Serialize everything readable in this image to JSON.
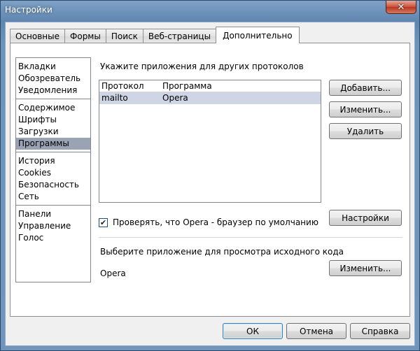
{
  "window": {
    "title": "Настройки",
    "close_label": "✕"
  },
  "tabs": [
    {
      "label": "Основные"
    },
    {
      "label": "Формы"
    },
    {
      "label": "Поиск"
    },
    {
      "label": "Веб-страницы"
    },
    {
      "label": "Дополнительно",
      "active": true
    }
  ],
  "sidebar": {
    "groups": [
      [
        "Вкладки",
        "Обозреватель",
        "Уведомления"
      ],
      [
        "Содержимое",
        "Шрифты",
        "Загрузки",
        "Программы"
      ],
      [
        "История",
        "Cookies",
        "Безопасность",
        "Сеть"
      ],
      [
        "Панели",
        "Управление",
        "Голос"
      ]
    ],
    "selected": "Программы"
  },
  "protocols": {
    "section_label": "Укажите приложения для других протоколов",
    "columns": [
      "Протокол",
      "Программа"
    ],
    "rows": [
      {
        "protocol": "mailto",
        "program": "Opera",
        "selected": true
      }
    ],
    "add_label": "Добавить...",
    "edit_label": "Изменить...",
    "delete_label": "Удалить"
  },
  "default_browser": {
    "checked": true,
    "check_mark": "✔",
    "label": "Проверять, что Opera - браузер по умолчанию",
    "settings_label": "Настройки"
  },
  "source_viewer": {
    "section_label": "Выберите приложение для просмотра исходного кода",
    "app": "Opera",
    "edit_label": "Изменить..."
  },
  "footer": {
    "ok_label": "ОК",
    "cancel_label": "Отмена",
    "help_label": "Справка"
  }
}
